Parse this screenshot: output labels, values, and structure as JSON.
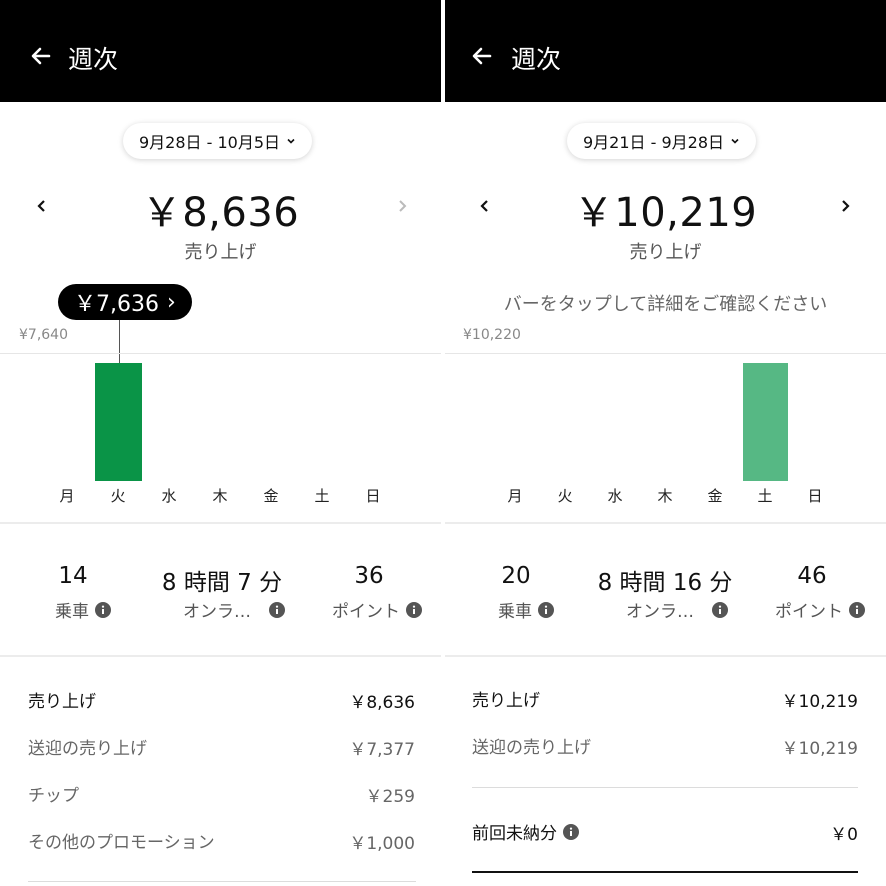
{
  "colors": {
    "bar_left": "#0a9447",
    "bar_right": "#56b884",
    "header_bg": "#000000"
  },
  "left": {
    "header": {
      "back_icon": "arrow-left-icon",
      "title": "週次"
    },
    "date_range": "9月28日 - 10月5日",
    "total": {
      "amount": "￥8,636",
      "label": "売り上げ"
    },
    "tooltip": {
      "value": "￥7,636",
      "arrow": "›"
    },
    "chart_data": {
      "type": "bar",
      "categories": [
        "月",
        "火",
        "水",
        "木",
        "金",
        "土",
        "日"
      ],
      "values": [
        0,
        7636,
        0,
        0,
        0,
        0,
        0
      ],
      "ymax_label": "¥7,640",
      "ylim": [
        0,
        7640
      ],
      "grid": true
    },
    "stats": [
      {
        "value": "14",
        "label": "乗車"
      },
      {
        "value": "8 時間 7 分",
        "label": "オンラ…"
      },
      {
        "value": "36",
        "label": "ポイント"
      }
    ],
    "breakdown": [
      {
        "label": "売り上げ",
        "value": "￥8,636"
      },
      {
        "label": "送迎の売り上げ",
        "value": "￥7,377"
      },
      {
        "label": "チップ",
        "value": "￥259"
      },
      {
        "label": "その他のプロモーション",
        "value": "￥1,000"
      }
    ]
  },
  "right": {
    "header": {
      "back_icon": "arrow-left-icon",
      "title": "週次"
    },
    "date_range": "9月21日 - 9月28日",
    "total": {
      "amount": "￥10,219",
      "label": "売り上げ"
    },
    "hint": "バーをタップして詳細をご確認ください",
    "chart_data": {
      "type": "bar",
      "categories": [
        "月",
        "火",
        "水",
        "木",
        "金",
        "土",
        "日"
      ],
      "values": [
        0,
        0,
        0,
        0,
        0,
        10219,
        0
      ],
      "ymax_label": "¥10,220",
      "ylim": [
        0,
        10220
      ],
      "grid": true
    },
    "stats": [
      {
        "value": "20",
        "label": "乗車"
      },
      {
        "value": "8 時間 16 分",
        "label": "オンラ…"
      },
      {
        "value": "46",
        "label": "ポイント"
      }
    ],
    "breakdown": [
      {
        "label": "売り上げ",
        "value": "￥10,219"
      },
      {
        "label": "送迎の売り上げ",
        "value": "￥10,219"
      }
    ],
    "unpaid": {
      "label": "前回未納分",
      "value": "￥0"
    }
  }
}
